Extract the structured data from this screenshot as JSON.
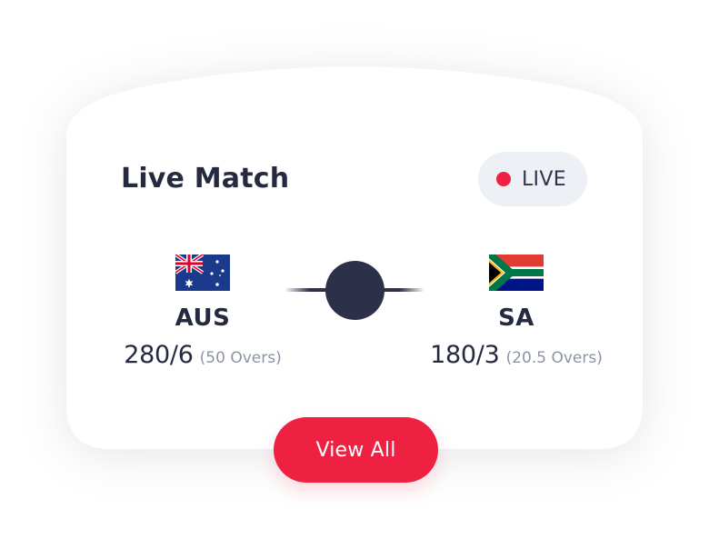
{
  "header": {
    "title": "Live Match",
    "live_label": "LIVE"
  },
  "teams": [
    {
      "code": "AUS",
      "score": "280/6",
      "overs": "(50 Overs)",
      "flag": "australia-flag"
    },
    {
      "code": "SA",
      "score": "180/3",
      "overs": "(20.5 Overs)",
      "flag": "south-africa-flag"
    }
  ],
  "actions": {
    "view_all_label": "View All"
  },
  "colors": {
    "accent": "#ef2142",
    "dark": "#252a40",
    "muted": "#8c93a7",
    "pill": "#edf0f4"
  }
}
